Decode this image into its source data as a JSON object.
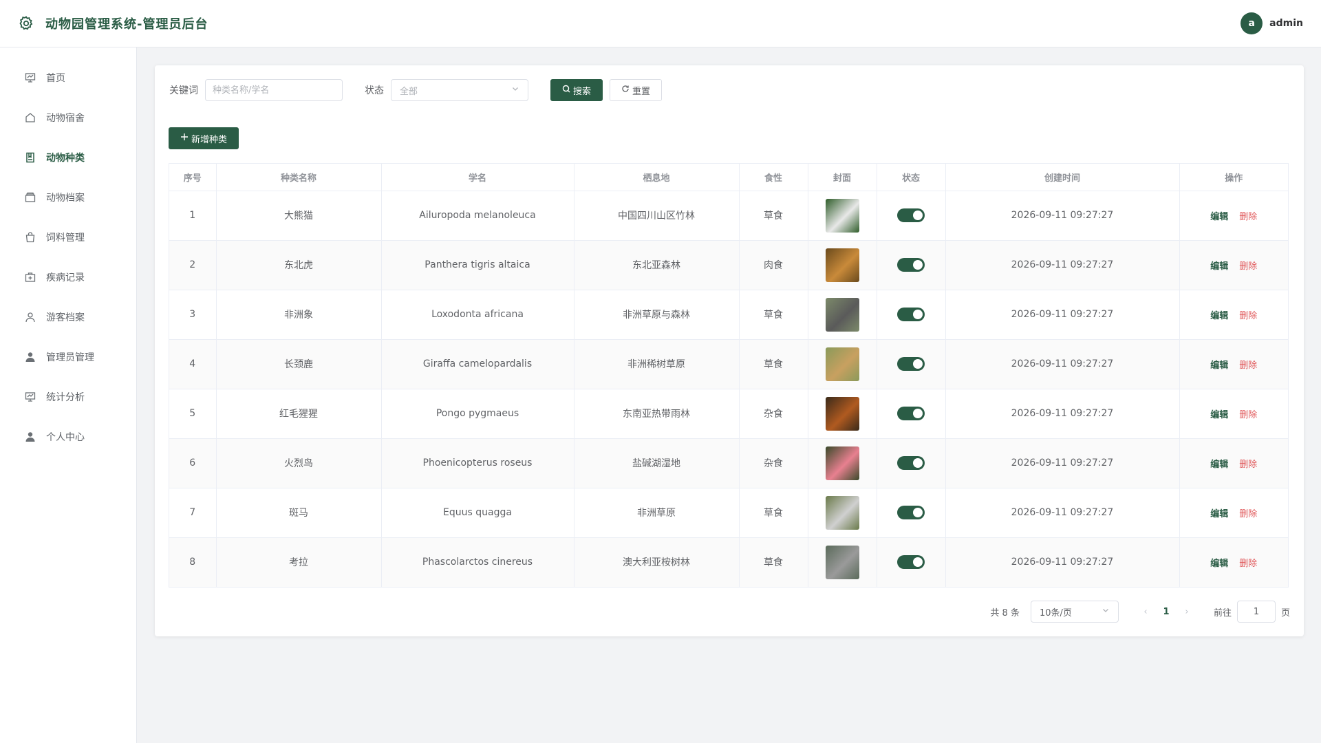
{
  "colors": {
    "accent": "#2a5c45",
    "danger": "#e0585a"
  },
  "header": {
    "title": "动物园管理系统-管理员后台",
    "avatar_letter": "a",
    "username": "admin"
  },
  "sidebar": {
    "items": [
      {
        "label": "首页",
        "icon": "dashboard-icon"
      },
      {
        "label": "动物宿舍",
        "icon": "home-icon"
      },
      {
        "label": "动物种类",
        "icon": "book-icon"
      },
      {
        "label": "动物档案",
        "icon": "folder-icon"
      },
      {
        "label": "饲料管理",
        "icon": "bag-icon"
      },
      {
        "label": "疾病记录",
        "icon": "medical-icon"
      },
      {
        "label": "游客档案",
        "icon": "user-icon"
      },
      {
        "label": "管理员管理",
        "icon": "admin-icon"
      },
      {
        "label": "统计分析",
        "icon": "chart-icon"
      },
      {
        "label": "个人中心",
        "icon": "person-icon"
      }
    ]
  },
  "filters": {
    "keyword_label": "关键词",
    "keyword_placeholder": "种类名称/学名",
    "status_label": "状态",
    "status_value": "全部",
    "search_label": "搜索",
    "reset_label": "重置"
  },
  "add_label": "新增种类",
  "table": {
    "columns": [
      "序号",
      "种类名称",
      "学名",
      "栖息地",
      "食性",
      "封面",
      "状态",
      "创建时间",
      "操作"
    ],
    "edit_label": "编辑",
    "delete_label": "删除",
    "rows": [
      {
        "idx": "1",
        "name": "大熊猫",
        "sci": "Ailuropoda melanoleuca",
        "habitat": "中国四川山区竹林",
        "diet": "草食",
        "enabled": true,
        "created": "2026-09-11 09:27:27"
      },
      {
        "idx": "2",
        "name": "东北虎",
        "sci": "Panthera tigris altaica",
        "habitat": "东北亚森林",
        "diet": "肉食",
        "enabled": true,
        "created": "2026-09-11 09:27:27"
      },
      {
        "idx": "3",
        "name": "非洲象",
        "sci": "Loxodonta africana",
        "habitat": "非洲草原与森林",
        "diet": "草食",
        "enabled": true,
        "created": "2026-09-11 09:27:27"
      },
      {
        "idx": "4",
        "name": "长颈鹿",
        "sci": "Giraffa camelopardalis",
        "habitat": "非洲稀树草原",
        "diet": "草食",
        "enabled": true,
        "created": "2026-09-11 09:27:27"
      },
      {
        "idx": "5",
        "name": "红毛猩猩",
        "sci": "Pongo pygmaeus",
        "habitat": "东南亚热带雨林",
        "diet": "杂食",
        "enabled": true,
        "created": "2026-09-11 09:27:27"
      },
      {
        "idx": "6",
        "name": "火烈鸟",
        "sci": "Phoenicopterus roseus",
        "habitat": "盐碱湖湿地",
        "diet": "杂食",
        "enabled": true,
        "created": "2026-09-11 09:27:27"
      },
      {
        "idx": "7",
        "name": "斑马",
        "sci": "Equus quagga",
        "habitat": "非洲草原",
        "diet": "草食",
        "enabled": true,
        "created": "2026-09-11 09:27:27"
      },
      {
        "idx": "8",
        "name": "考拉",
        "sci": "Phascolarctos cinereus",
        "habitat": "澳大利亚桉树林",
        "diet": "草食",
        "enabled": true,
        "created": "2026-09-11 09:27:27"
      }
    ]
  },
  "pagination": {
    "total": "共 8 条",
    "page_size": "10条/页",
    "current": "1",
    "goto_label": "前往",
    "goto_value": "1",
    "page_suffix": "页"
  }
}
